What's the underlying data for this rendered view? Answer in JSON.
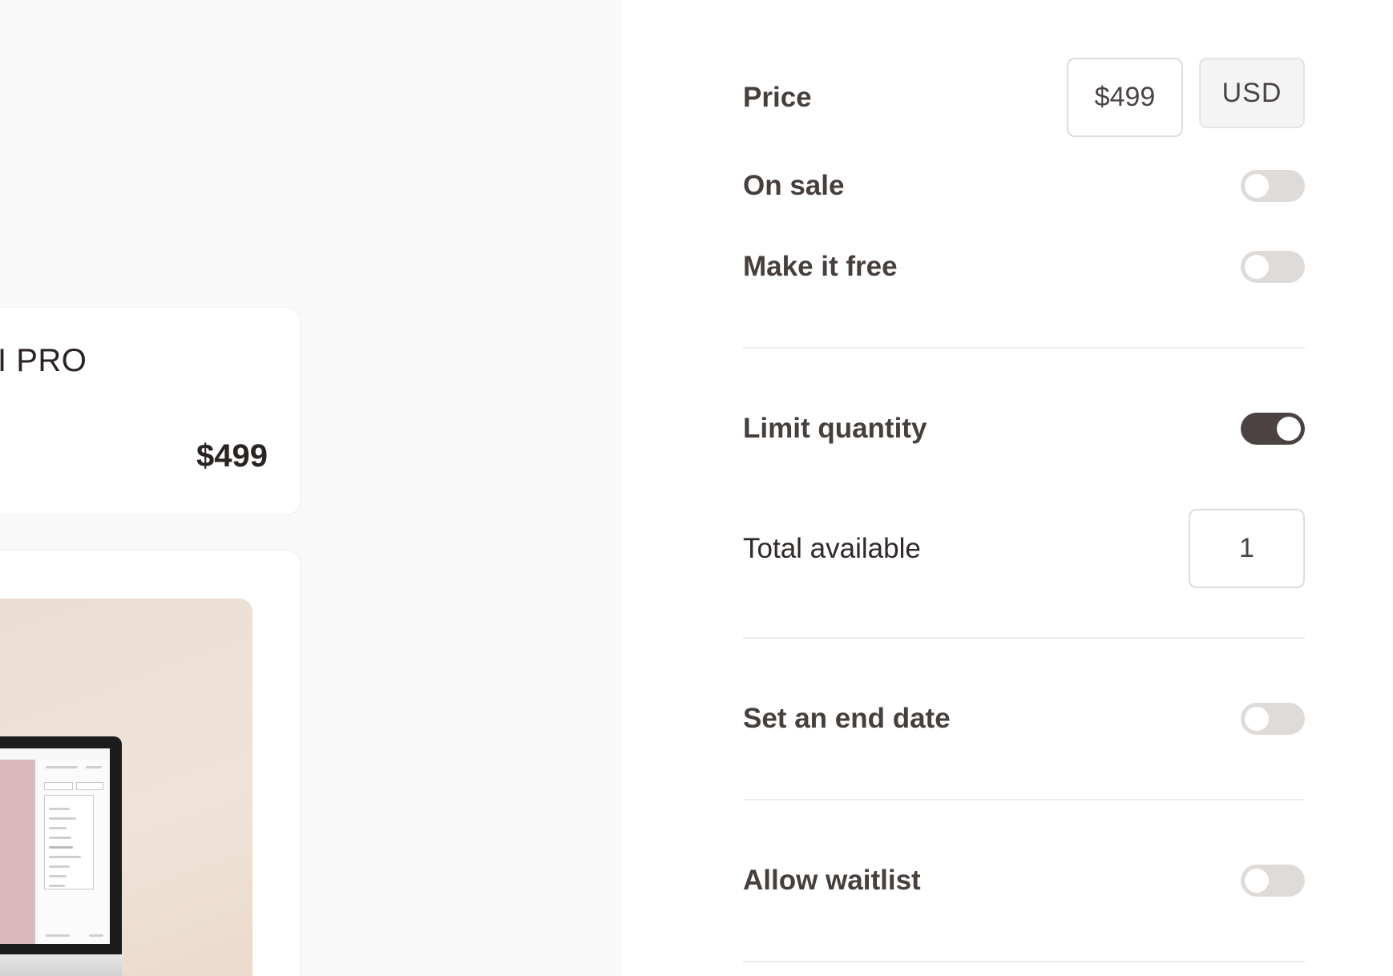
{
  "preview": {
    "product_name": "I PRO",
    "product_price": "$499"
  },
  "settings": {
    "price": {
      "label": "Price",
      "value": "$499",
      "currency": "USD"
    },
    "on_sale": {
      "label": "On sale",
      "enabled": false
    },
    "make_free": {
      "label": "Make it free",
      "enabled": false
    },
    "limit_quantity": {
      "label": "Limit quantity",
      "enabled": true
    },
    "total_available": {
      "label": "Total available",
      "value": "1"
    },
    "end_date": {
      "label": "Set an end date",
      "enabled": false
    },
    "waitlist": {
      "label": "Allow waitlist",
      "enabled": false
    }
  },
  "colors": {
    "toggle_on": "#4b4341",
    "toggle_off": "#dedbd9",
    "text": "#463f3c",
    "image_bg": "#eadcd1",
    "screen_pink": "#d9b8bc"
  }
}
